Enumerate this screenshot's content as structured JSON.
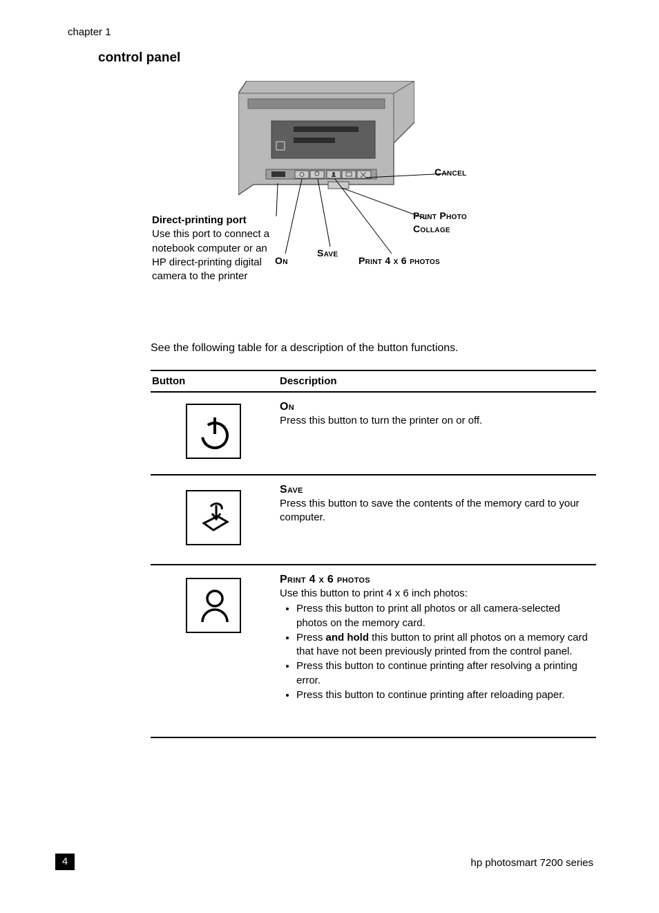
{
  "chapter_label": "chapter 1",
  "section_heading": "control panel",
  "callouts": {
    "direct_port": {
      "title": "Direct-printing port",
      "body": "Use this port to connect a notebook computer or an HP direct-printing digital camera to the printer"
    },
    "on": "On",
    "save": "Save",
    "print4x6": "Print 4 x 6 photos",
    "collage": "Print Photo Collage",
    "cancel": "Cancel"
  },
  "table_intro": "See the following table for a description of the button functions.",
  "table": {
    "header_button": "Button",
    "header_description": "Description",
    "rows": [
      {
        "title": "On",
        "body": "Press this button to turn the printer on or off."
      },
      {
        "title": "Save",
        "body": "Press this button to save the contents of the memory card to your computer."
      },
      {
        "title": "Print 4 x 6 photos",
        "intro": "Use this button to print 4 x 6 inch photos:",
        "bullets": {
          "b0": "Press this button to print all photos or all camera-selected photos on the memory card.",
          "b1_pre": "Press ",
          "b1_bold": "and hold",
          "b1_post": " this button to print all photos on a memory card that have not been previously printed from the control panel.",
          "b2": "Press this button to continue printing after resolving a printing error.",
          "b3": "Press this button to continue printing after reloading paper."
        }
      }
    ]
  },
  "page_number": "4",
  "footer": "hp photosmart 7200 series"
}
